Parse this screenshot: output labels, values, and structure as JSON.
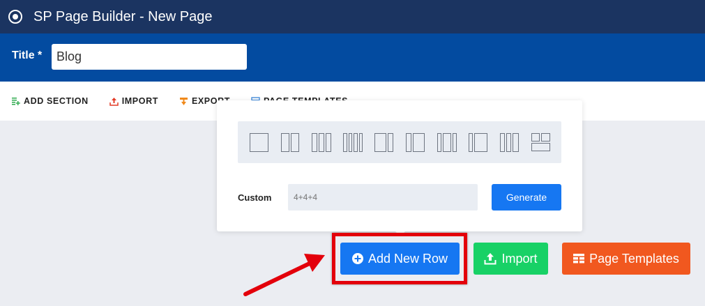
{
  "header": {
    "app_title": "SP Page Builder - New Page"
  },
  "title_field": {
    "label": "Title *",
    "value": "Blog"
  },
  "toolbar": {
    "items": [
      {
        "label": "ADD SECTION",
        "icon": "add-section-icon",
        "color": "#2eaa4e"
      },
      {
        "label": "IMPORT",
        "icon": "import-icon",
        "color": "#e33b26"
      },
      {
        "label": "EXPORT",
        "icon": "export-icon",
        "color": "#f0891a"
      },
      {
        "label": "PAGE TEMPLATES",
        "icon": "page-templates-icon",
        "color": "#3a86d8"
      }
    ]
  },
  "row_popover": {
    "layouts": [
      "1",
      "1+1",
      "1+1+1",
      "1+1+1+1",
      "2+1",
      "1+2",
      "1+2+1",
      "1+3",
      "1+1+1 (narrow)",
      "2-over-2"
    ],
    "custom_label": "Custom",
    "custom_placeholder": "4+4+4",
    "generate_label": "Generate"
  },
  "actions": {
    "add_row": "Add New Row",
    "import": "Import",
    "page_templates": "Page Templates"
  },
  "colors": {
    "topbar": "#1b3461",
    "titlebar": "#034ba0",
    "primary": "#1677f2",
    "success": "#18d166",
    "orange": "#f1581f",
    "highlight": "#e3000b"
  }
}
